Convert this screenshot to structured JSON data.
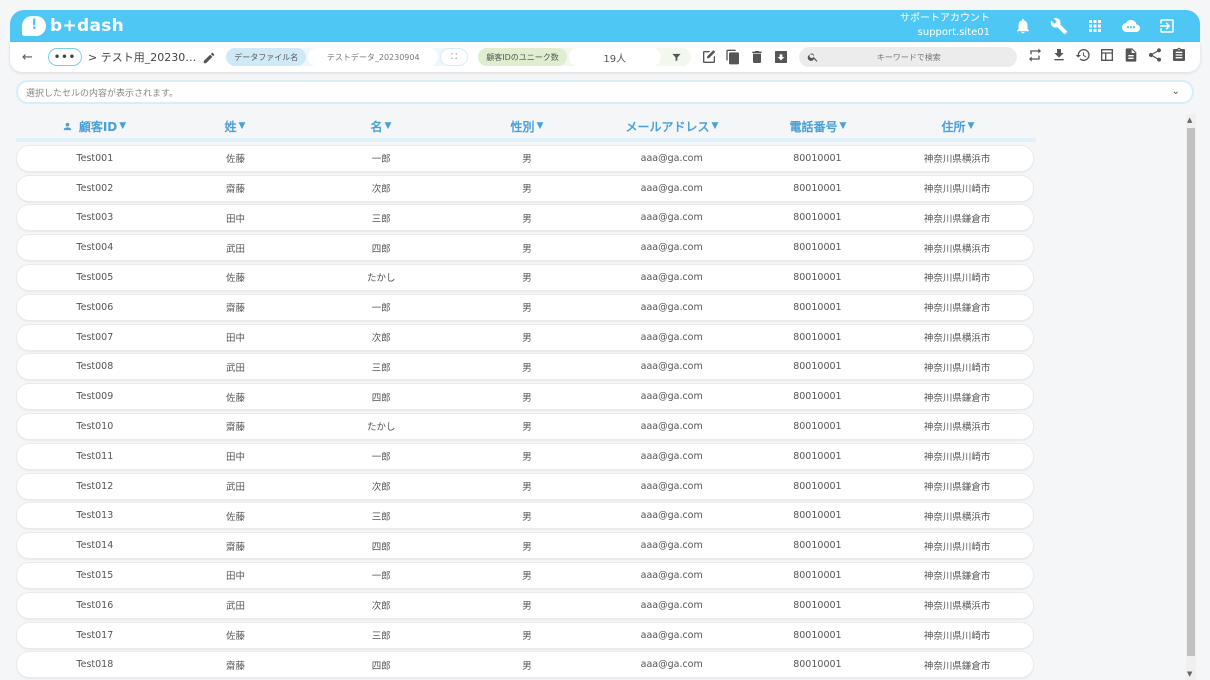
{
  "app": {
    "brand": "b+dash",
    "account_name": "サポートアカウント",
    "account_id": "support.site01"
  },
  "header_icons": [
    "bell-icon",
    "wrench-icon",
    "apps-grid-icon",
    "cloud-chat-icon",
    "logout-icon"
  ],
  "toolbar": {
    "more_label": "•••",
    "breadcrumb": "> テスト用_20230…",
    "file_label": "データファイル名",
    "file_value": "テストデータ_20230904",
    "expand_label": "⛶",
    "unique_label": "顧客IDのユニーク数",
    "unique_value": "19人",
    "search_placeholder": "キーワードで検索"
  },
  "cellbar": {
    "placeholder": "選択したセルの内容が表示されます。"
  },
  "table": {
    "columns": [
      "顧客ID",
      "姓",
      "名",
      "性別",
      "メールアドレス",
      "電話番号",
      "住所"
    ],
    "rows": [
      [
        "Test001",
        "佐藤",
        "一郎",
        "男",
        "aaa@ga.com",
        "80010001",
        "神奈川県横浜市"
      ],
      [
        "Test002",
        "齋藤",
        "次郎",
        "男",
        "aaa@ga.com",
        "80010001",
        "神奈川県川崎市"
      ],
      [
        "Test003",
        "田中",
        "三郎",
        "男",
        "aaa@ga.com",
        "80010001",
        "神奈川県鎌倉市"
      ],
      [
        "Test004",
        "武田",
        "四郎",
        "男",
        "aaa@ga.com",
        "80010001",
        "神奈川県横浜市"
      ],
      [
        "Test005",
        "佐藤",
        "たかし",
        "男",
        "aaa@ga.com",
        "80010001",
        "神奈川県川崎市"
      ],
      [
        "Test006",
        "齋藤",
        "一郎",
        "男",
        "aaa@ga.com",
        "80010001",
        "神奈川県鎌倉市"
      ],
      [
        "Test007",
        "田中",
        "次郎",
        "男",
        "aaa@ga.com",
        "80010001",
        "神奈川県横浜市"
      ],
      [
        "Test008",
        "武田",
        "三郎",
        "男",
        "aaa@ga.com",
        "80010001",
        "神奈川県川崎市"
      ],
      [
        "Test009",
        "佐藤",
        "四郎",
        "男",
        "aaa@ga.com",
        "80010001",
        "神奈川県鎌倉市"
      ],
      [
        "Test010",
        "齋藤",
        "たかし",
        "男",
        "aaa@ga.com",
        "80010001",
        "神奈川県横浜市"
      ],
      [
        "Test011",
        "田中",
        "一郎",
        "男",
        "aaa@ga.com",
        "80010001",
        "神奈川県川崎市"
      ],
      [
        "Test012",
        "武田",
        "次郎",
        "男",
        "aaa@ga.com",
        "80010001",
        "神奈川県鎌倉市"
      ],
      [
        "Test013",
        "佐藤",
        "三郎",
        "男",
        "aaa@ga.com",
        "80010001",
        "神奈川県横浜市"
      ],
      [
        "Test014",
        "齋藤",
        "四郎",
        "男",
        "aaa@ga.com",
        "80010001",
        "神奈川県川崎市"
      ],
      [
        "Test015",
        "田中",
        "一郎",
        "男",
        "aaa@ga.com",
        "80010001",
        "神奈川県鎌倉市"
      ],
      [
        "Test016",
        "武田",
        "次郎",
        "男",
        "aaa@ga.com",
        "80010001",
        "神奈川県横浜市"
      ],
      [
        "Test017",
        "佐藤",
        "三郎",
        "男",
        "aaa@ga.com",
        "80010001",
        "神奈川県川崎市"
      ],
      [
        "Test018",
        "齋藤",
        "四郎",
        "男",
        "aaa@ga.com",
        "80010001",
        "神奈川県鎌倉市"
      ]
    ]
  },
  "colors": {
    "header_bg": "#4fc7f5",
    "column_header_text": "#4aa0d8"
  }
}
